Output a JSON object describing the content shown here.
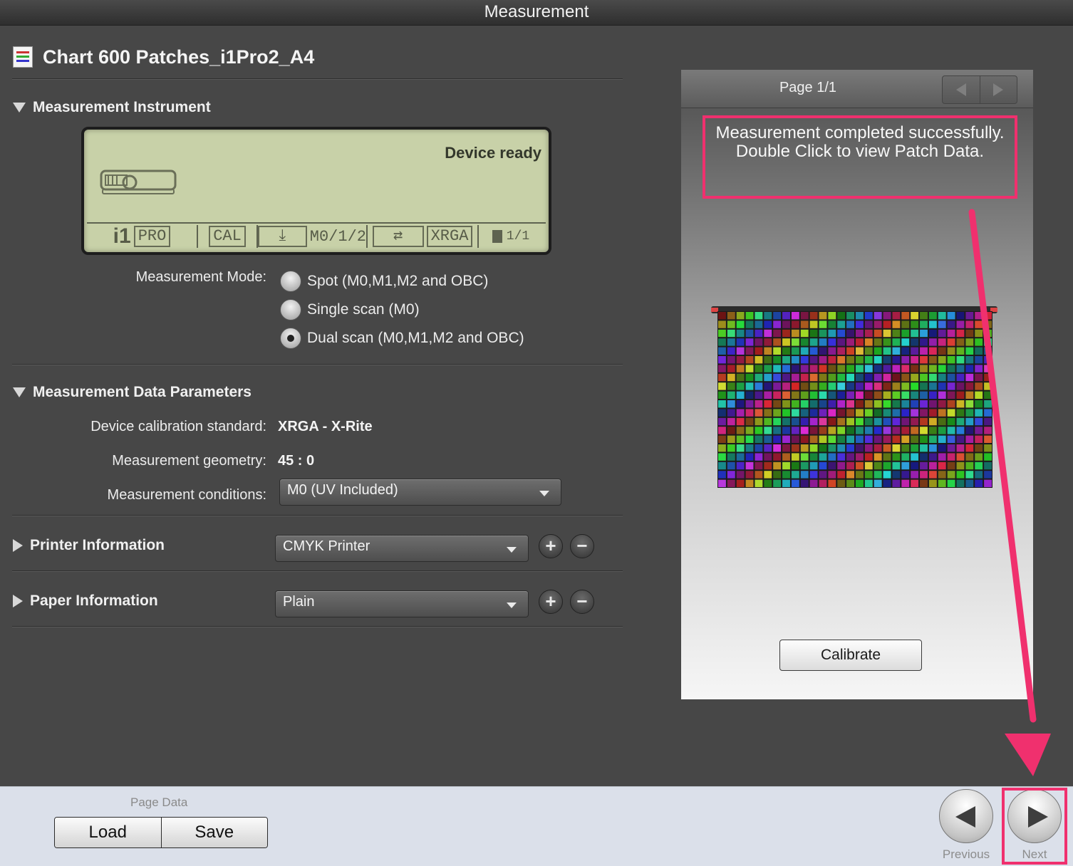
{
  "window": {
    "title": "Measurement"
  },
  "chart": {
    "title": "Chart 600 Patches_i1Pro2_A4"
  },
  "instrument": {
    "section_title": "Measurement Instrument",
    "status": "Device ready",
    "lcd": {
      "brand": "i1",
      "model": "PRO",
      "cal": "CAL",
      "mode": "M0/1/2",
      "standard": "XRGA",
      "page": "1/1"
    },
    "mode_label": "Measurement Mode:",
    "modes": [
      {
        "label": "Spot (M0,M1,M2 and OBC)",
        "checked": false
      },
      {
        "label": "Single scan (M0)",
        "checked": false
      },
      {
        "label": "Dual scan (M0,M1,M2 and OBC)",
        "checked": true
      }
    ]
  },
  "data_params": {
    "section_title": "Measurement Data Parameters",
    "calibration_label": "Device calibration standard:",
    "calibration_value": "XRGA - X-Rite",
    "geometry_label": "Measurement geometry:",
    "geometry_value": "45 : 0",
    "conditions_label": "Measurement conditions:",
    "conditions_value": "M0 (UV Included)"
  },
  "printer": {
    "section_title": "Printer Information",
    "selected": "CMYK Printer"
  },
  "paper": {
    "section_title": "Paper Information",
    "selected": "Plain"
  },
  "preview": {
    "page_label": "Page 1/1",
    "message": "Measurement completed successfully. Double Click to view Patch Data.",
    "calibrate_label": "Calibrate"
  },
  "footer": {
    "page_data_label": "Page Data",
    "load_label": "Load",
    "save_label": "Save",
    "previous_label": "Previous",
    "next_label": "Next"
  },
  "colors": {
    "highlight": "#f0306e",
    "lcd_background": "#c8d1a8"
  }
}
